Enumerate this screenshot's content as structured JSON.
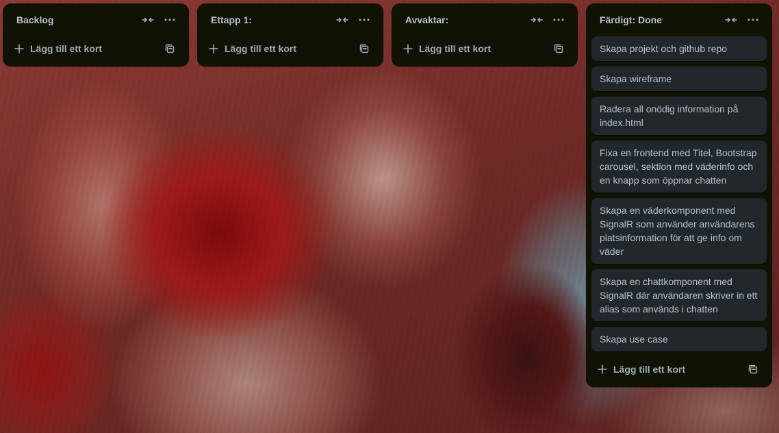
{
  "board": {
    "lists": [
      {
        "title": "Backlog",
        "add_card_label": "Lägg till ett kort",
        "cards": []
      },
      {
        "title": "Ettapp 1:",
        "add_card_label": "Lägg till ett kort",
        "cards": []
      },
      {
        "title": "Avvaktar:",
        "add_card_label": "Lägg till ett kort",
        "cards": []
      },
      {
        "title": "Färdigt: Done",
        "add_card_label": "Lägg till ett kort",
        "cards": [
          "Skapa projekt och github repo",
          "Skapa wireframe",
          "Radera all onödig information på index.html",
          "Fixa en frontend med Titel, Bootstrap carousel, sektion med väderinfo och en knapp som öppnar chatten",
          "Skapa en väderkomponent med SignalR som använder användarens platsinformation för att ge info om väder",
          "Skapa en chattkomponent med SignalR där användaren skriver in ett alias som används i chatten",
          "Skapa use case"
        ]
      }
    ]
  },
  "icons": {
    "collapse": "collapse-arrows-icon",
    "more": "more-dots-icon",
    "add": "plus-icon",
    "template": "card-template-icon"
  },
  "colors": {
    "list_bg": "#101204",
    "card_bg": "#22272b",
    "text": "#b6c2cf"
  }
}
